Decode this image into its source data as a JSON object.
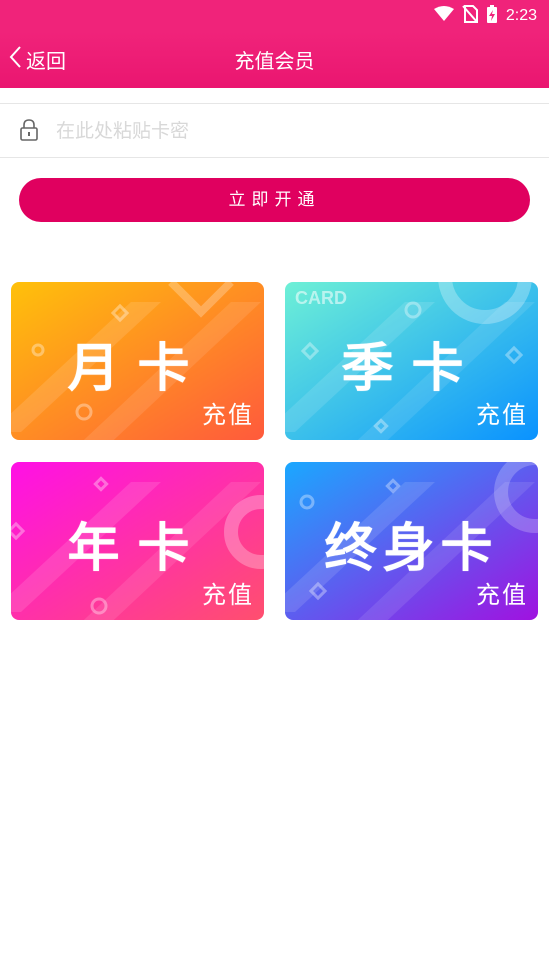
{
  "status_bar": {
    "time": "2:23"
  },
  "header": {
    "back_label": "返回",
    "title": "充值会员"
  },
  "card_input": {
    "placeholder": "在此处粘贴卡密",
    "value": ""
  },
  "activate_button": {
    "label": "立即开通"
  },
  "cards": [
    {
      "title": "月卡",
      "subtitle": "充值",
      "tag": ""
    },
    {
      "title": "季卡",
      "subtitle": "充值",
      "tag": "CARD"
    },
    {
      "title": "年卡",
      "subtitle": "充值",
      "tag": ""
    },
    {
      "title": "终身卡",
      "subtitle": "充值",
      "tag": ""
    }
  ],
  "colors": {
    "accent": "#f0237a",
    "button": "#e0005f",
    "placeholder": "#d8d8d8"
  }
}
